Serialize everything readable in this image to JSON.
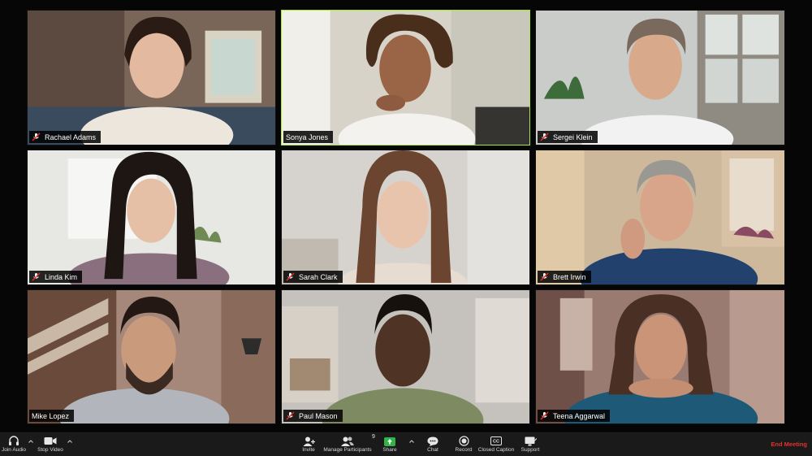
{
  "participants": [
    {
      "name": "Rachael Adams",
      "muted": true
    },
    {
      "name": "Sonya Jones",
      "muted": false,
      "active_speaker": true
    },
    {
      "name": "Sergei Klein",
      "muted": true
    },
    {
      "name": "Linda Kim",
      "muted": true
    },
    {
      "name": "Sarah Clark",
      "muted": true
    },
    {
      "name": "Brett Irwin",
      "muted": true
    },
    {
      "name": "Mike Lopez",
      "muted": false
    },
    {
      "name": "Paul Mason",
      "muted": true
    },
    {
      "name": "Teena Aggarwal",
      "muted": true
    }
  ],
  "toolbar": {
    "join_audio": "Join Audio",
    "stop_video": "Stop Video",
    "invite": "Invite",
    "manage_participants": "Manage Participants",
    "participant_count": "9",
    "share": "Share",
    "chat": "Chat",
    "record": "Record",
    "closed_caption": "Closed Caption",
    "support": "Support",
    "end_meeting": "End Meeting"
  },
  "colors": {
    "active_speaker_border": "#a5e838",
    "share_green": "#2fb44a",
    "end_meeting_red": "#e8302c",
    "mute_red": "#e0302a"
  }
}
